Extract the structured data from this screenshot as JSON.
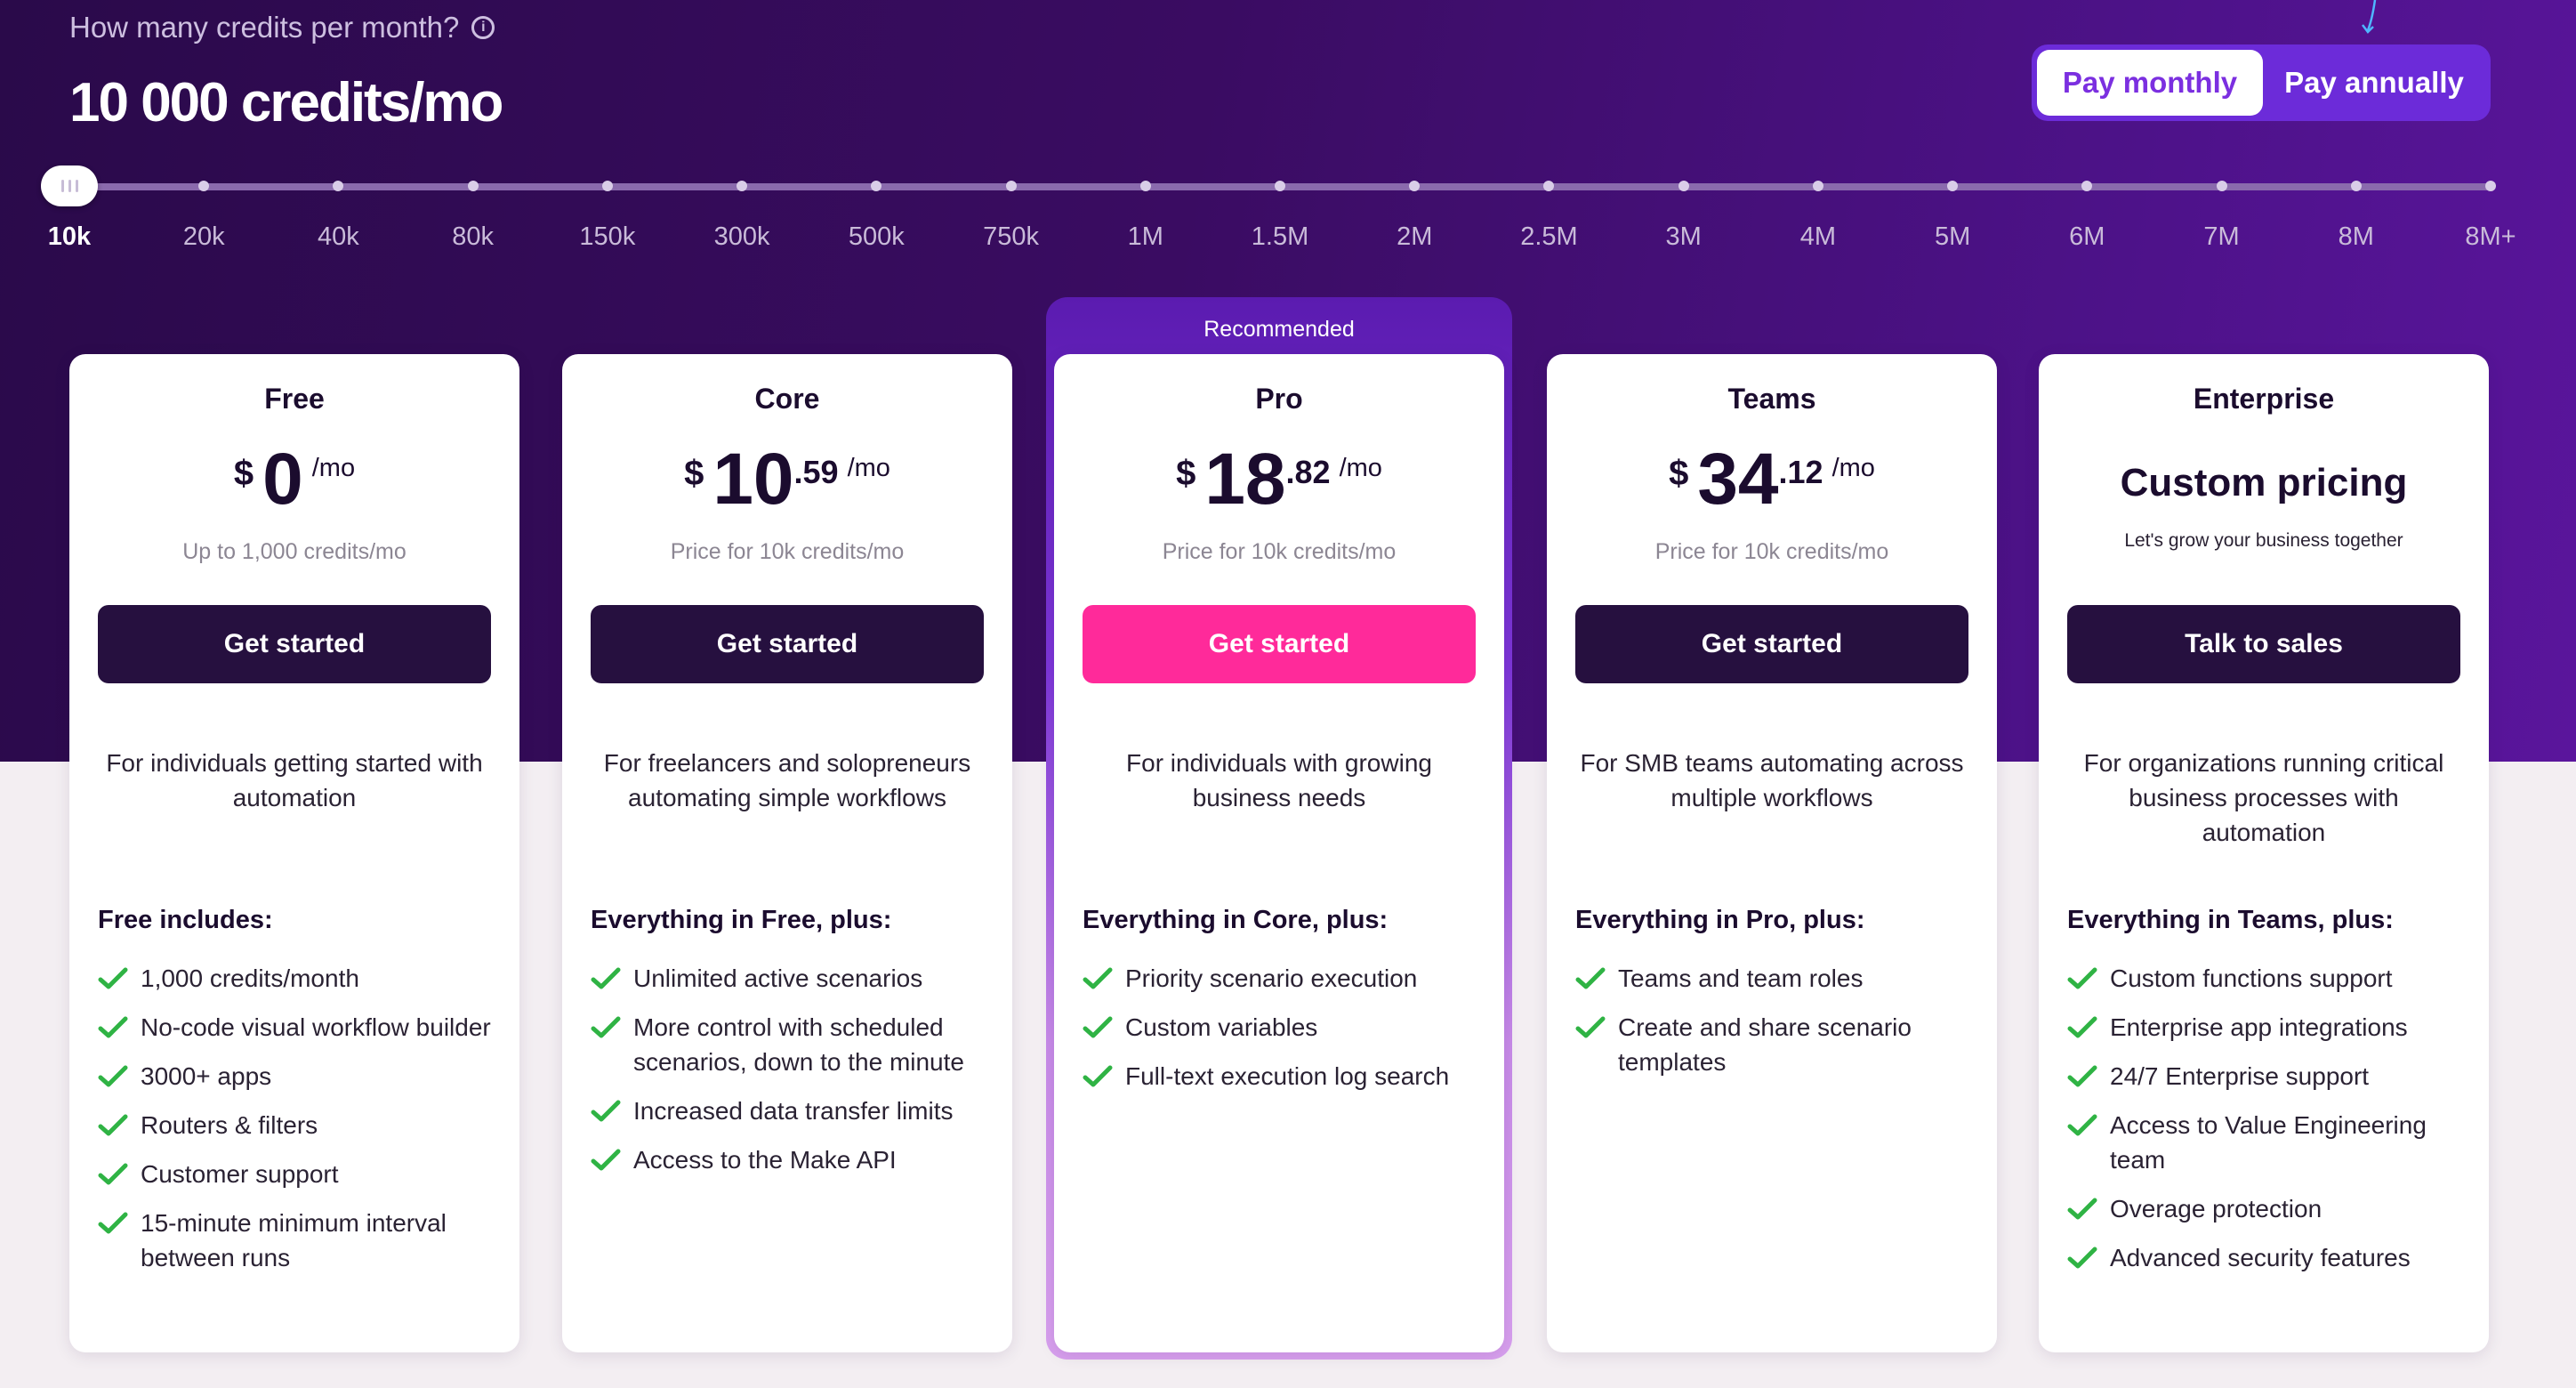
{
  "header": {
    "question": "How many credits per month?",
    "credits_value": "10 000 credits/mo",
    "billing": {
      "monthly": "Pay monthly",
      "annually": "Pay annually",
      "selected": "monthly"
    }
  },
  "slider": {
    "selected_index": 0,
    "ticks": [
      "10k",
      "20k",
      "40k",
      "80k",
      "150k",
      "300k",
      "500k",
      "750k",
      "1M",
      "1.5M",
      "2M",
      "2.5M",
      "3M",
      "4M",
      "5M",
      "6M",
      "7M",
      "8M",
      "8M+"
    ]
  },
  "recommended_label": "Recommended",
  "plans": [
    {
      "name": "Free",
      "currency": "$",
      "price_int": "0",
      "price_dec": "",
      "per": "/mo",
      "note": "Up to 1,000 credits/mo",
      "cta": "Get started",
      "description": "For individuals getting started with automation",
      "includes_title": "Free includes:",
      "features": [
        "1,000 credits/month",
        "No-code visual workflow builder",
        "3000+ apps",
        "Routers & filters",
        "Customer support",
        "15-minute minimum interval between runs"
      ]
    },
    {
      "name": "Core",
      "currency": "$",
      "price_int": "10",
      "price_dec": ".59",
      "per": "/mo",
      "note": "Price for 10k credits/mo",
      "cta": "Get started",
      "description": "For freelancers and solopreneurs automating simple workflows",
      "includes_title": "Everything in Free, plus:",
      "features": [
        "Unlimited active scenarios",
        "More control with scheduled scenarios, down to the minute",
        "Increased data transfer limits",
        "Access to the Make API"
      ]
    },
    {
      "name": "Pro",
      "currency": "$",
      "price_int": "18",
      "price_dec": ".82",
      "per": "/mo",
      "note": "Price for 10k credits/mo",
      "cta": "Get started",
      "description": "For individuals with growing business needs",
      "includes_title": "Everything in Core, plus:",
      "features": [
        "Priority scenario execution",
        "Custom variables",
        "Full-text execution log search"
      ]
    },
    {
      "name": "Teams",
      "currency": "$",
      "price_int": "34",
      "price_dec": ".12",
      "per": "/mo",
      "note": "Price for 10k credits/mo",
      "cta": "Get started",
      "description": "For SMB teams automating across multiple workflows",
      "includes_title": "Everything in Pro, plus:",
      "features": [
        "Teams and team roles",
        "Create and share scenario templates"
      ]
    },
    {
      "name": "Enterprise",
      "custom_price": "Custom pricing",
      "note": "Let's grow your business together",
      "cta": "Talk to sales",
      "description": "For organizations running critical business processes with automation",
      "includes_title": "Everything in Teams, plus:",
      "features": [
        "Custom functions support",
        "Enterprise app integrations",
        "24/7 Enterprise support",
        "Access to Value Engineering team",
        "Overage protection",
        "Advanced security features"
      ]
    }
  ],
  "colors": {
    "hero_bg": "#3a0c62",
    "cta_dark": "#26103f",
    "cta_recommended": "#ff2a9a",
    "toggle_accent": "#6c2bd9",
    "check": "#2fb344"
  },
  "icons": {
    "info": "info-circle-icon",
    "check": "checkmark-icon",
    "slider_handle": "grip-icon"
  }
}
